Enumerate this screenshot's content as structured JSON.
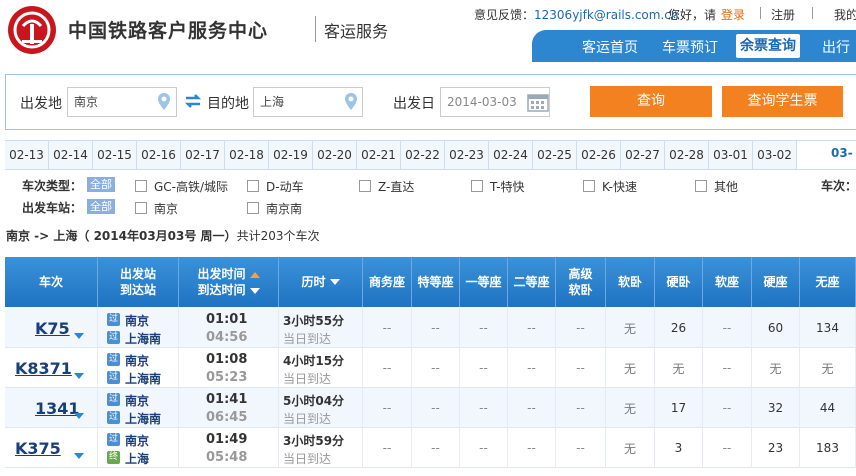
{
  "header": {
    "brand": "中国铁路客户服务中心",
    "sub": "客运服务",
    "feedback_label": "意见反馈：",
    "feedback_email": "12306yjfk@rails.com.cn",
    "greeting": "您好，请",
    "login": "登录",
    "register": "注册",
    "mine": "我的"
  },
  "nav": [
    "客运首页",
    "车票预订",
    "余票查询",
    "出行"
  ],
  "search": {
    "from_label": "出发地",
    "from_value": "南京",
    "to_label": "目的地",
    "to_value": "上海",
    "date_label": "出发日",
    "date_value": "2014-03-03",
    "query_btn": "查询",
    "student_btn": "查询学生票"
  },
  "dates": [
    "02-13",
    "02-14",
    "02-15",
    "02-16",
    "02-17",
    "02-18",
    "02-19",
    "02-20",
    "02-21",
    "02-22",
    "02-23",
    "02-24",
    "02-25",
    "02-26",
    "02-27",
    "02-28",
    "03-01",
    "03-02"
  ],
  "date_current": "03-",
  "filters": {
    "type_label": "车次类型：",
    "station_label": "出发车站：",
    "all": "全部",
    "types": [
      "GC-高铁/城际",
      "D-动车",
      "Z-直达",
      "T-特快",
      "K-快速",
      "其他"
    ],
    "stations": [
      "南京",
      "南京南"
    ],
    "right_label": "车次："
  },
  "summary": {
    "route": "南京  -> 上海",
    "date": "（ 2014年03月03号  周一）",
    "count": "共计203个车次"
  },
  "table_headers": {
    "train": "车次",
    "station1": "出发站",
    "station2": "到达站",
    "time1": "出发时间",
    "time2": "到达时间",
    "duration": "历时",
    "seats": [
      "商务座",
      "特等座",
      "一等座",
      "二等座",
      "高级\n软卧",
      "软卧",
      "硬卧",
      "软座",
      "硬座",
      "无座"
    ]
  },
  "rows": [
    {
      "code": "K75",
      "from": "南京",
      "to": "上海南",
      "from_tag": "过",
      "to_tag": "过",
      "dep": "01:01",
      "arr": "04:56",
      "dur": "3小时55分",
      "arrive": "当日到达",
      "seats": [
        "--",
        "--",
        "--",
        "--",
        "--",
        "无",
        "26",
        "--",
        "60",
        "134"
      ]
    },
    {
      "code": "K8371",
      "from": "南京",
      "to": "上海南",
      "from_tag": "过",
      "to_tag": "过",
      "dep": "01:08",
      "arr": "05:23",
      "dur": "4小时15分",
      "arrive": "当日到达",
      "seats": [
        "--",
        "--",
        "--",
        "--",
        "--",
        "无",
        "无",
        "--",
        "无",
        "无"
      ]
    },
    {
      "code": "1341",
      "from": "南京",
      "to": "上海南",
      "from_tag": "过",
      "to_tag": "过",
      "dep": "01:41",
      "arr": "06:45",
      "dur": "5小时04分",
      "arrive": "当日到达",
      "seats": [
        "--",
        "--",
        "--",
        "--",
        "--",
        "无",
        "17",
        "--",
        "32",
        "44"
      ]
    },
    {
      "code": "K375",
      "from": "南京",
      "to": "上海",
      "from_tag": "过",
      "to_tag": "终",
      "dep": "01:49",
      "arr": "05:48",
      "dur": "3小时59分",
      "arrive": "当日到达",
      "seats": [
        "--",
        "--",
        "--",
        "--",
        "--",
        "无",
        "3",
        "--",
        "23",
        "183"
      ]
    }
  ]
}
